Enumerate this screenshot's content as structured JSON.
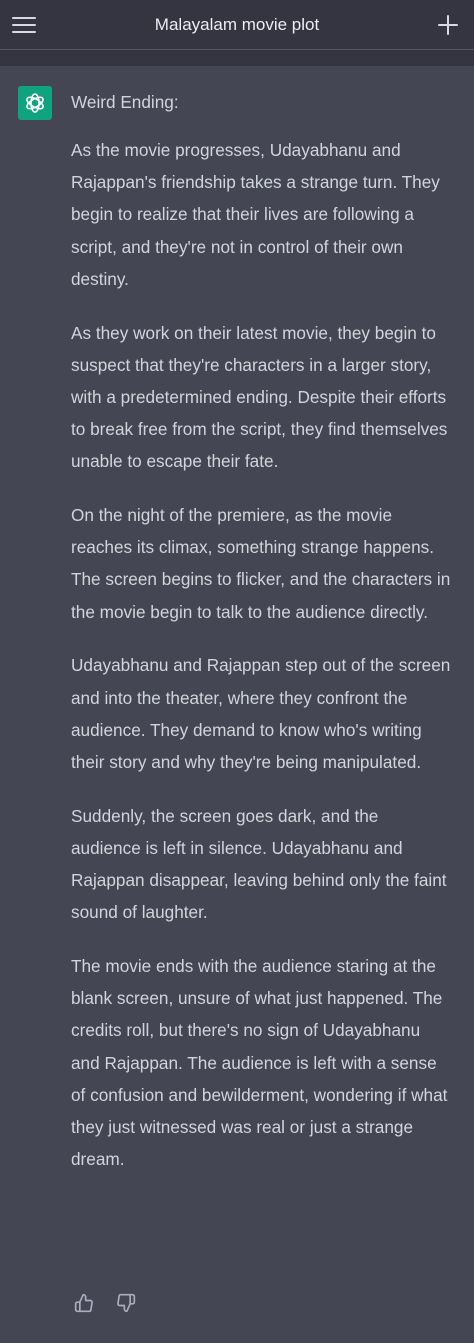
{
  "header": {
    "title": "Malayalam movie plot",
    "menu_icon": "hamburger-menu-icon",
    "new_chat_icon": "plus-icon"
  },
  "message": {
    "avatar_icon": "openai-logo-icon",
    "heading": "Weird Ending:",
    "paragraphs": [
      "As the movie progresses, Udayabhanu and Rajappan's friendship takes a strange turn. They begin to realize that their lives are following a script, and they're not in control of their own destiny.",
      "As they work on their latest movie, they begin to suspect that they're characters in a larger story, with a predetermined ending. Despite their efforts to break free from the script, they find themselves unable to escape their fate.",
      "On the night of the premiere, as the movie reaches its climax, something strange happens. The screen begins to flicker, and the characters in the movie begin to talk to the audience directly.",
      "Udayabhanu and Rajappan step out of the screen and into the theater, where they confront the audience. They demand to know who's writing their story and why they're being manipulated.",
      "Suddenly, the screen goes dark, and the audience is left in silence. Udayabhanu and Rajappan disappear, leaving behind only the faint sound of laughter.",
      "The movie ends with the audience staring at the blank screen, unsure of what just happened. The credits roll, but there's no sign of Udayabhanu and Rajappan. The audience is left with a sense of confusion and bewilderment, wondering if what they just witnessed was real or just a strange dream."
    ],
    "feedback_icons": [
      "thumbs-up-icon",
      "thumbs-down-icon"
    ]
  },
  "colors": {
    "header_bg": "#343541",
    "message_bg": "#444654",
    "text": "#d1d5db",
    "avatar_bg": "#10a37f"
  }
}
